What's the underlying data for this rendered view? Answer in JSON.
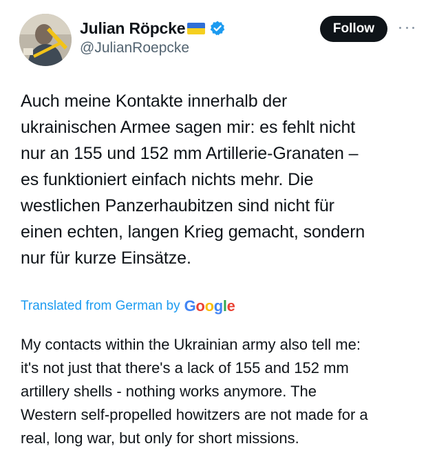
{
  "author": {
    "display_name": "Julian Röpcke",
    "handle": "@JulianRoepcke",
    "flag_icon": "ukraine-flag",
    "verified_icon": "verified-badge",
    "verified_color": "#1d9bf0"
  },
  "actions": {
    "follow_label": "Follow",
    "more_icon": "more-horizontal-icon"
  },
  "tweet": {
    "text": "Auch meine Kontakte innerhalb der\nukrainischen Armee sagen mir: es fehlt nicht\nnur an 155 und 152 mm Artillerie-Granaten –\nes funktioniert einfach nichts mehr. Die\nwestlichen Panzerhaubitzen sind nicht für\neinen echten, langen Krieg gemacht, sondern\nnur für kurze Einsätze."
  },
  "translation": {
    "label": "Translated from German by",
    "provider_logo": "Google",
    "text": "My contacts within the Ukrainian army also tell me:\nit's not just that there's a lack of 155 and 152 mm\nartillery shells - nothing works anymore. The\nWestern self-propelled howitzers are not made for a\nreal, long war, but only for short missions."
  },
  "colors": {
    "link": "#1d9bf0",
    "text": "#0f1419",
    "secondary": "#536471",
    "follow_bg": "#0f1419"
  }
}
